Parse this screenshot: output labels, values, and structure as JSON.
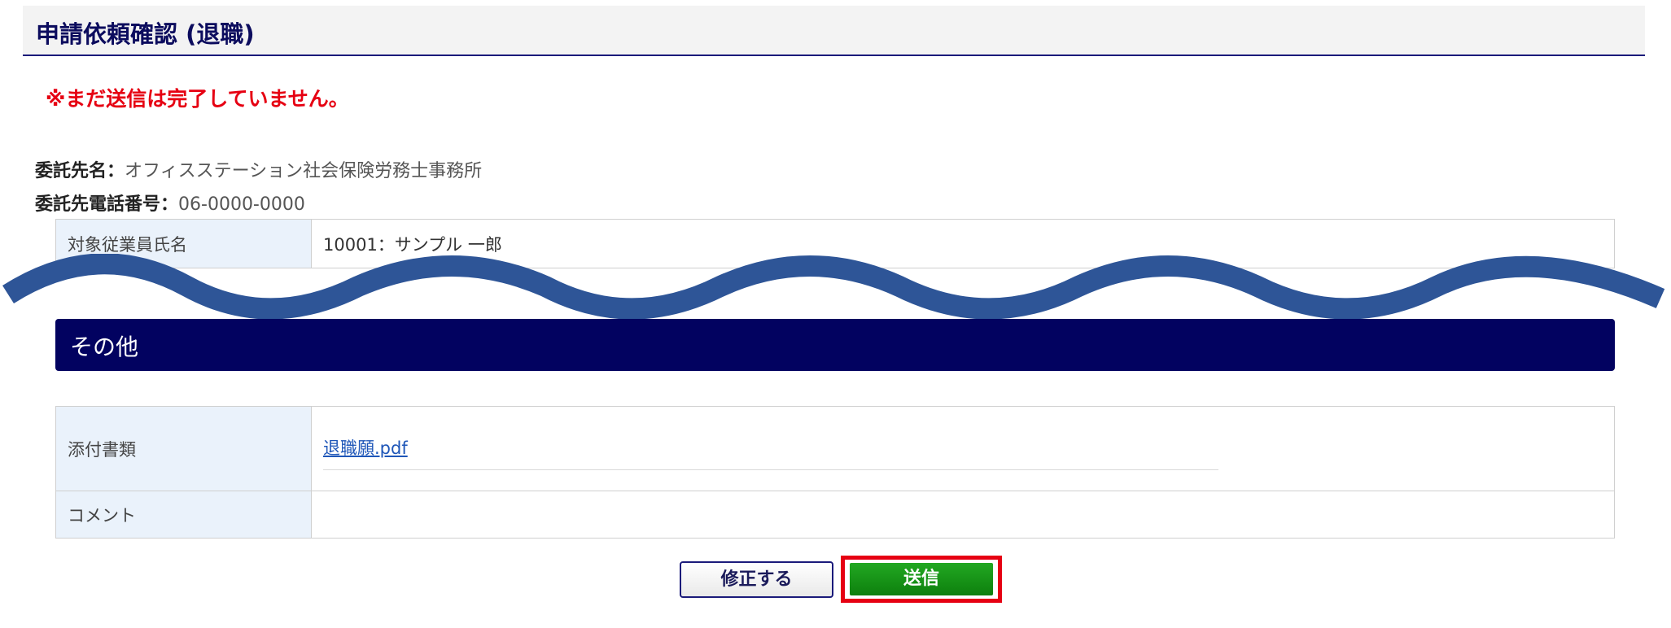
{
  "header": {
    "title": "申請依頼確認 (退職)"
  },
  "warning": "※まだ送信は完了していません。",
  "info": {
    "contractor_label": "委託先名：",
    "contractor_value": "オフィスステーション社会保険労務士事務所",
    "phone_label": "委託先電話番号：",
    "phone_value": "06-0000-0000"
  },
  "employee_table": {
    "label": "対象従業員氏名",
    "value": "10001：サンプル 一郎"
  },
  "section": {
    "title": "その他"
  },
  "other_table": {
    "attachment_label": "添付書類",
    "attachment_file": "退職願.pdf",
    "comment_label": "コメント",
    "comment_value": ""
  },
  "buttons": {
    "edit_label": "修正する",
    "send_label": "送信"
  },
  "colors": {
    "header_title": "#0c0c5e",
    "warning": "#e60012",
    "section_bar": "#020260",
    "wave": "#2e5597",
    "send_button": "#1a961a",
    "highlight_frame": "#e60012"
  }
}
